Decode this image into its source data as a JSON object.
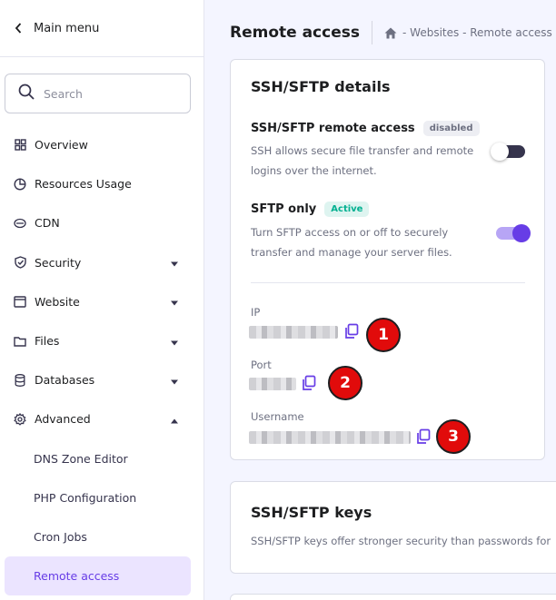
{
  "sidebar": {
    "main_menu_label": "Main menu",
    "search_placeholder": "Search",
    "items": [
      {
        "label": "Overview"
      },
      {
        "label": "Resources Usage"
      },
      {
        "label": "CDN"
      },
      {
        "label": "Security"
      },
      {
        "label": "Website"
      },
      {
        "label": "Files"
      },
      {
        "label": "Databases"
      },
      {
        "label": "Advanced"
      },
      {
        "label": "DNS Zone Editor"
      },
      {
        "label": "PHP Configuration"
      },
      {
        "label": "Cron Jobs"
      },
      {
        "label": "Remote access"
      }
    ]
  },
  "header": {
    "title": "Remote access",
    "breadcrumb": [
      "Websites",
      "Remote access"
    ],
    "breadcrumb_sep": "-"
  },
  "ssh_card": {
    "title": "SSH/SFTP details",
    "remote_access": {
      "title": "SSH/SFTP remote access",
      "badge": "disabled",
      "description": "SSH allows secure file transfer and remote logins over the internet.",
      "enabled": false
    },
    "sftp_only": {
      "title": "SFTP only",
      "badge": "Active",
      "description": "Turn SFTP access on or off to securely transfer and manage your server files.",
      "enabled": true
    },
    "fields": [
      {
        "label": "IP",
        "marker": "1"
      },
      {
        "label": "Port",
        "marker": "2"
      },
      {
        "label": "Username",
        "marker": "3"
      }
    ]
  },
  "keys_card": {
    "title": "SSH/SFTP keys",
    "description": "SSH/SFTP keys offer stronger security than passwords for"
  },
  "colors": {
    "accent": "#673de6",
    "active_bg": "#ebe4ff",
    "success": "#00b090",
    "marker": "#e10b0b"
  },
  "icons": {
    "search": "search-icon",
    "home": "home-icon",
    "copy": "copy-icon",
    "back": "chevron-left-icon"
  }
}
